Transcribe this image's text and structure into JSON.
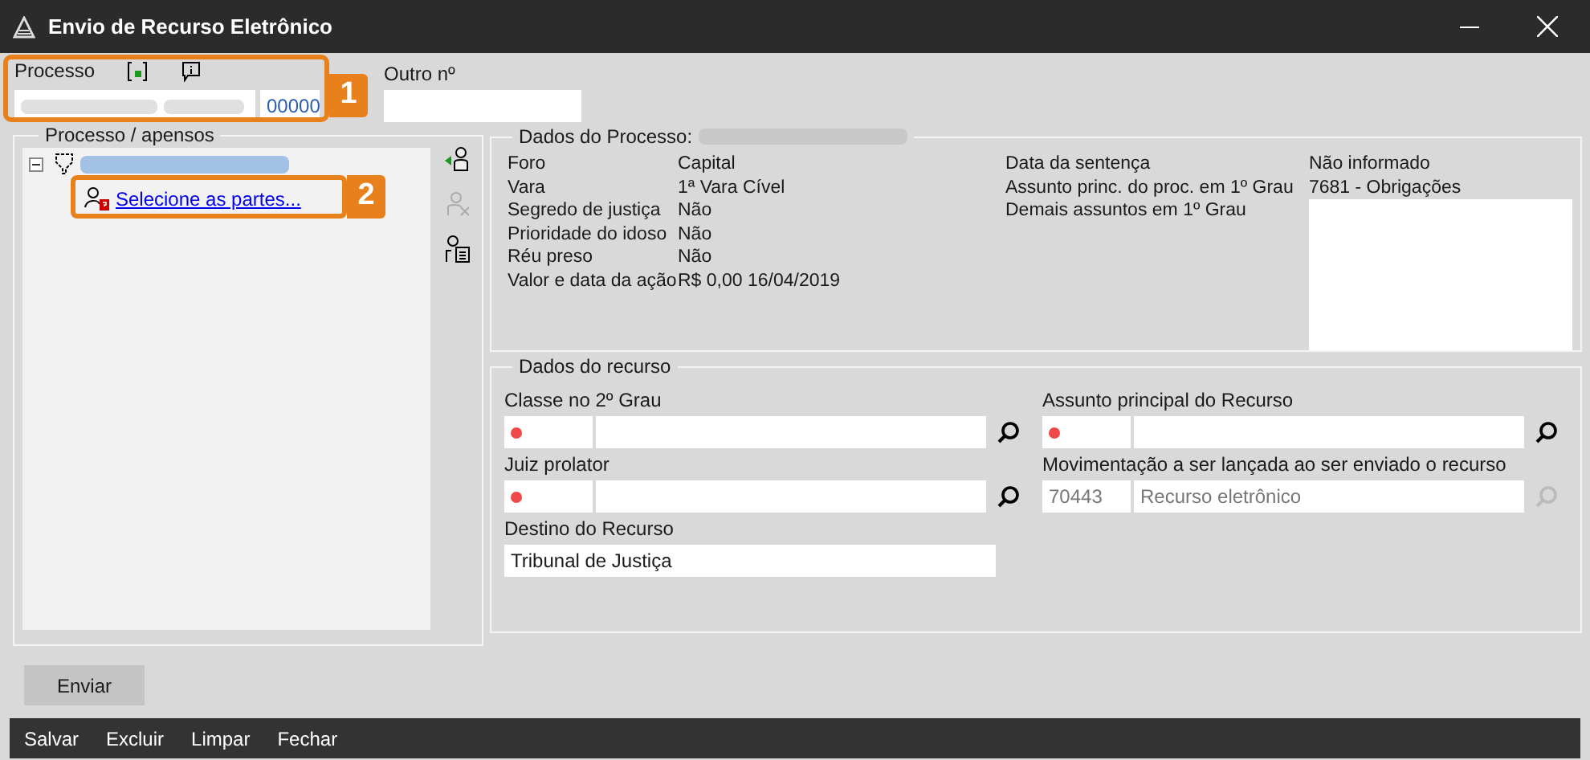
{
  "window": {
    "title": "Envio de Recurso Eletrônico"
  },
  "processo": {
    "label": "Processo",
    "suffix": "00000"
  },
  "outro": {
    "label": "Outro nº"
  },
  "apensos": {
    "title": "Processo / apensos",
    "tree": [
      {
        "expanded": true,
        "children": [
          {
            "label": "Selecione as partes..."
          }
        ]
      }
    ]
  },
  "dados_processo": {
    "title": "Dados do Processo:",
    "left": [
      {
        "label": "Foro",
        "value": "Capital"
      },
      {
        "label": "Vara",
        "value": "1ª Vara Cível"
      },
      {
        "label": "Segredo de justiça",
        "value": "Não"
      },
      {
        "label": "Prioridade do idoso",
        "value": "Não"
      },
      {
        "label": "Réu preso",
        "value": "Não"
      },
      {
        "label": "Valor e data da ação",
        "value": "R$ 0,00 16/04/2019"
      }
    ],
    "right": [
      {
        "label": "Data da sentença",
        "value": "Não informado"
      },
      {
        "label": "Assunto princ. do proc. em 1º Grau",
        "value": "7681 - Obrigações"
      },
      {
        "label": "Demais assuntos em 1º Grau"
      }
    ]
  },
  "dados_recurso": {
    "title": "Dados do recurso",
    "fields": [
      {
        "label": "Classe no 2º Grau",
        "required": true,
        "disabled": false,
        "kind": "lookup"
      },
      {
        "label": "Assunto principal do Recurso",
        "required": true,
        "disabled": false,
        "kind": "lookup"
      },
      {
        "label": "Juiz prolator",
        "required": true,
        "disabled": false,
        "kind": "lookup"
      },
      {
        "label": "Movimentação a ser lançada ao ser enviado o recurso",
        "code": "70443",
        "value": "Recurso eletrônico",
        "required": false,
        "disabled": true,
        "kind": "lookup"
      },
      {
        "label": "Destino do Recurso",
        "value": "Tribunal de Justiça",
        "kind": "text"
      }
    ]
  },
  "send_button": "Enviar",
  "bottom_menu": [
    "Salvar",
    "Excluir",
    "Limpar",
    "Fechar"
  ],
  "callouts": [
    "1",
    "2"
  ]
}
